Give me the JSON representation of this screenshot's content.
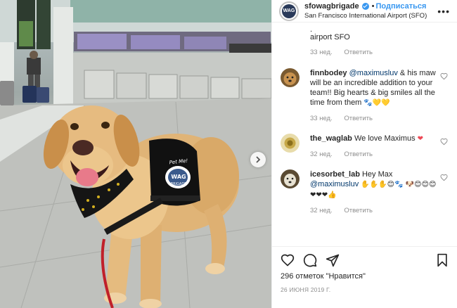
{
  "post": {
    "username": "sfowagbrigade",
    "follow_label": "Подписаться",
    "location": "San Francisco International Airport (SFO)",
    "avatar_text": "WAG"
  },
  "vest": {
    "line1": "Pet Me!",
    "line2": "WAG",
    "line3": "BRIGADE"
  },
  "caption_tail": {
    "text": "airport SFO",
    "age": "33 нед.",
    "reply_label": "Ответить"
  },
  "comments": [
    {
      "username": "finnbodey",
      "mention": "@maximusluv",
      "text": " & his maw will be an incredible addition to your team!! Big hearts & big smiles all the time from them",
      "emoji": "🐾💛💛",
      "age": "33 нед.",
      "reply_label": "Ответить",
      "avatar_color": "#b07a3a"
    },
    {
      "username": "the_waglab",
      "mention": "",
      "text": "We love Maximus",
      "emoji": "❤",
      "age": "32 нед.",
      "reply_label": "Ответить",
      "avatar_color": "#d8c27a"
    },
    {
      "username": "icesorbet_lab",
      "mention": "@maximusluv",
      "text": "Hey Max",
      "emoji": "✋✋✋😊🐾 🐶😊😊😊❤❤❤👍",
      "age": "32 нед.",
      "reply_label": "Ответить",
      "avatar_color": "#6b5a3e"
    }
  ],
  "actions": {
    "likes": "296 отметок \"Нравится\"",
    "date": "26 ИЮНЯ 2019 Г."
  },
  "colors": {
    "accent": "#3897f0",
    "heart": "#ed4956",
    "muted": "#8e8e8e"
  }
}
